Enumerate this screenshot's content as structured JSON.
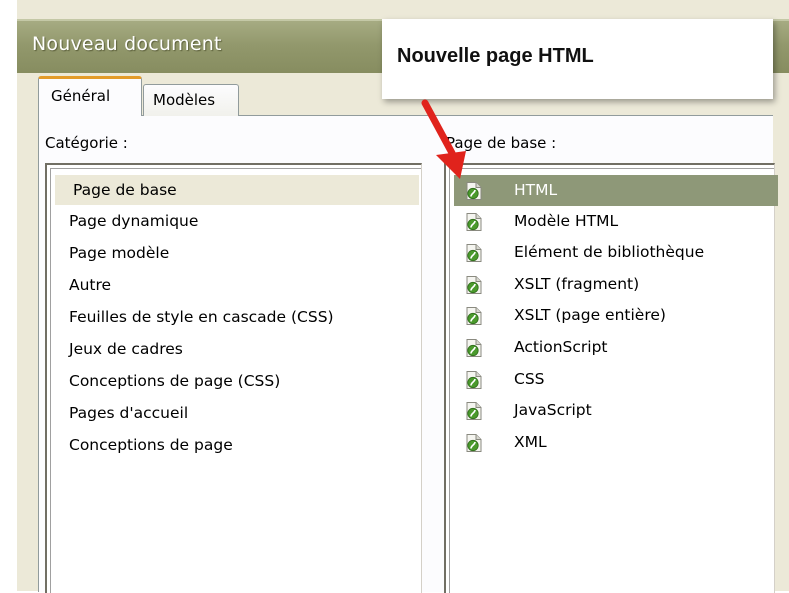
{
  "window": {
    "title": "Nouveau document"
  },
  "tabs": [
    {
      "label": "Général",
      "active": true
    },
    {
      "label": "Modèles",
      "active": false
    }
  ],
  "category_panel": {
    "label": "Catégorie :",
    "items": [
      {
        "label": "Page de base",
        "selected": true
      },
      {
        "label": "Page dynamique"
      },
      {
        "label": "Page modèle"
      },
      {
        "label": "Autre"
      },
      {
        "label": "Feuilles de style en cascade (CSS)"
      },
      {
        "label": "Jeux de cadres"
      },
      {
        "label": "Conceptions de page (CSS)"
      },
      {
        "label": "Pages d'accueil"
      },
      {
        "label": "Conceptions de page"
      }
    ]
  },
  "page_panel": {
    "label": "Page de base :",
    "items": [
      {
        "label": "HTML",
        "icon": "document-icon",
        "selected": true
      },
      {
        "label": "Modèle HTML",
        "icon": "document-icon"
      },
      {
        "label": "Elément de bibliothèque",
        "icon": "document-icon"
      },
      {
        "label": "XSLT (fragment)",
        "icon": "document-icon"
      },
      {
        "label": "XSLT (page entière)",
        "icon": "document-icon"
      },
      {
        "label": "ActionScript",
        "icon": "document-icon"
      },
      {
        "label": "CSS",
        "icon": "document-icon"
      },
      {
        "label": "JavaScript",
        "icon": "document-icon"
      },
      {
        "label": "XML",
        "icon": "document-icon"
      }
    ]
  },
  "callout": {
    "text": "Nouvelle page HTML",
    "arrow_color": "#e0231c"
  },
  "colors": {
    "titlebar": "#979c70",
    "selection_page": "#8e9878",
    "selection_category": "#ece9d8",
    "tab_highlight": "#e39b2a",
    "icon_green": "#4a9a2c"
  }
}
